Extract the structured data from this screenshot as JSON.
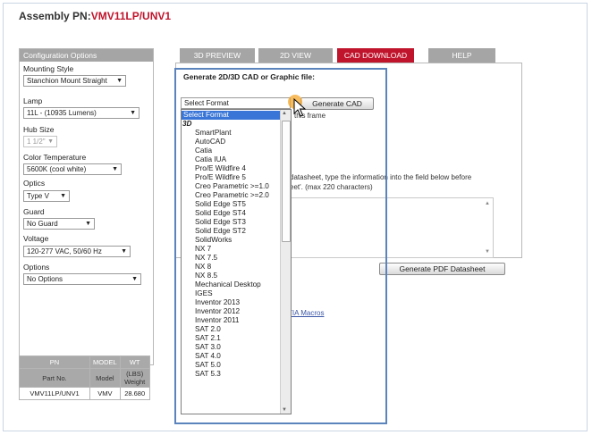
{
  "page": {
    "title_prefix": "Assembly PN:",
    "title_pn": "VMV11LP/UNV1"
  },
  "config": {
    "header": "Configuration Options",
    "fields": [
      {
        "label": "Mounting Style",
        "value": "Stanchion Mount Straight"
      },
      {
        "label": "Lamp",
        "value": "11L - (10935 Lumens)"
      },
      {
        "label": "Hub Size",
        "value": "1 1/2\""
      },
      {
        "label": "Color Temperature",
        "value": "5600K (cool white)"
      },
      {
        "label": "Optics",
        "value": "Type V"
      },
      {
        "label": "Guard",
        "value": "No Guard"
      },
      {
        "label": "Voltage",
        "value": "120-277 VAC, 50/60 Hz"
      },
      {
        "label": "Options",
        "value": "No Options"
      }
    ]
  },
  "table": {
    "headers": [
      "PN",
      "MODEL",
      "WT"
    ],
    "headers_sub": [
      "Part No.",
      "Model",
      "(LBS) Weight"
    ],
    "row": [
      "VMV11LP/UNV1",
      "VMV",
      "28.680"
    ]
  },
  "tabs": [
    {
      "label": "3D PREVIEW",
      "active": false
    },
    {
      "label": "2D VIEW",
      "active": false
    },
    {
      "label": "CAD DOWNLOAD",
      "active": true
    },
    {
      "label": "HELP",
      "active": false
    }
  ],
  "cad": {
    "heading": "Generate 2D/3D CAD or Graphic file:",
    "format_select": "Select Format",
    "generate_button": "Generate CAD",
    "frame_text": "this frame",
    "datasheet_line1": "datasheet, type the information into the field below before",
    "datasheet_line2": "eet'. (max 220 characters)",
    "pdf_button": "Generate PDF Datasheet",
    "macros_link": "TIA Macros"
  },
  "dropdown": {
    "selected": "Select Format",
    "group": "3D",
    "options": [
      "SmartPlant",
      "AutoCAD",
      "Catia",
      "Catia IUA",
      "Pro/E Wildfire 4",
      "Pro/E Wildfire 5",
      "Creo Parametric >=1.0",
      "Creo Parametric >=2.0",
      "Solid Edge ST5",
      "Solid Edge ST4",
      "Solid Edge ST3",
      "Solid Edge ST2",
      "SolidWorks",
      "NX 7",
      "NX 7.5",
      "NX 8",
      "NX 8.5",
      "Mechanical Desktop",
      "IGES",
      "Inventor 2013",
      "Inventor 2012",
      "Inventor 2011",
      "SAT 2.0",
      "SAT 2.1",
      "SAT 3.0",
      "SAT 4.0",
      "SAT 5.0",
      "SAT 5.3"
    ]
  },
  "colors": {
    "accent": "#c0142c",
    "tab_inactive": "#a5a5a5",
    "highlight_frame": "#5b84bd",
    "selection": "#3875d7"
  }
}
